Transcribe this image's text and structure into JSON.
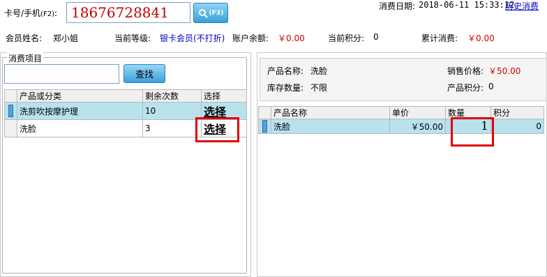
{
  "header": {
    "card_label": "卡号/手机",
    "card_hotkey": "(F2)",
    "card_value": "18676728841",
    "search_hotkey": "(F3)",
    "date_label": "消费日期:",
    "date_value": "2018-06-11 15:33:12",
    "history_link": "历史消费"
  },
  "member": {
    "name_label": "会员姓名:",
    "name_value": "郑小姐",
    "level_label": "当前等级:",
    "level_value": "银卡会员(不打折)",
    "balance_label": "账户余额:",
    "balance_value": "￥0.00",
    "points_label": "当前积分:",
    "points_value": "0",
    "total_label": "累计消费:",
    "total_value": "￥0.00"
  },
  "left": {
    "group_title": "消费项目",
    "search_placeholder": "",
    "search_button": "查找",
    "columns": [
      "产品或分类",
      "剩余次数",
      "选择"
    ],
    "rows": [
      {
        "name": "洗剪吹按摩护理",
        "remaining": "10",
        "action": "选择"
      },
      {
        "name": "洗脸",
        "remaining": "3",
        "action": "选择"
      }
    ]
  },
  "right": {
    "product_name_label": "产品名称:",
    "product_name_value": "洗脸",
    "price_label": "销售价格:",
    "price_value": "￥50.00",
    "stock_label": "库存数量:",
    "stock_value": "不限",
    "points_label": "产品积分:",
    "points_value": "0",
    "columns": [
      "产品名称",
      "单价",
      "数量",
      "积分"
    ],
    "rows": [
      {
        "name": "洗脸",
        "price": "￥50.00",
        "qty": "1",
        "points": "0"
      }
    ]
  },
  "colors": {
    "accent_red": "#e00000",
    "selected_row": "#b8e2ee",
    "link_blue": "#0000cc"
  }
}
